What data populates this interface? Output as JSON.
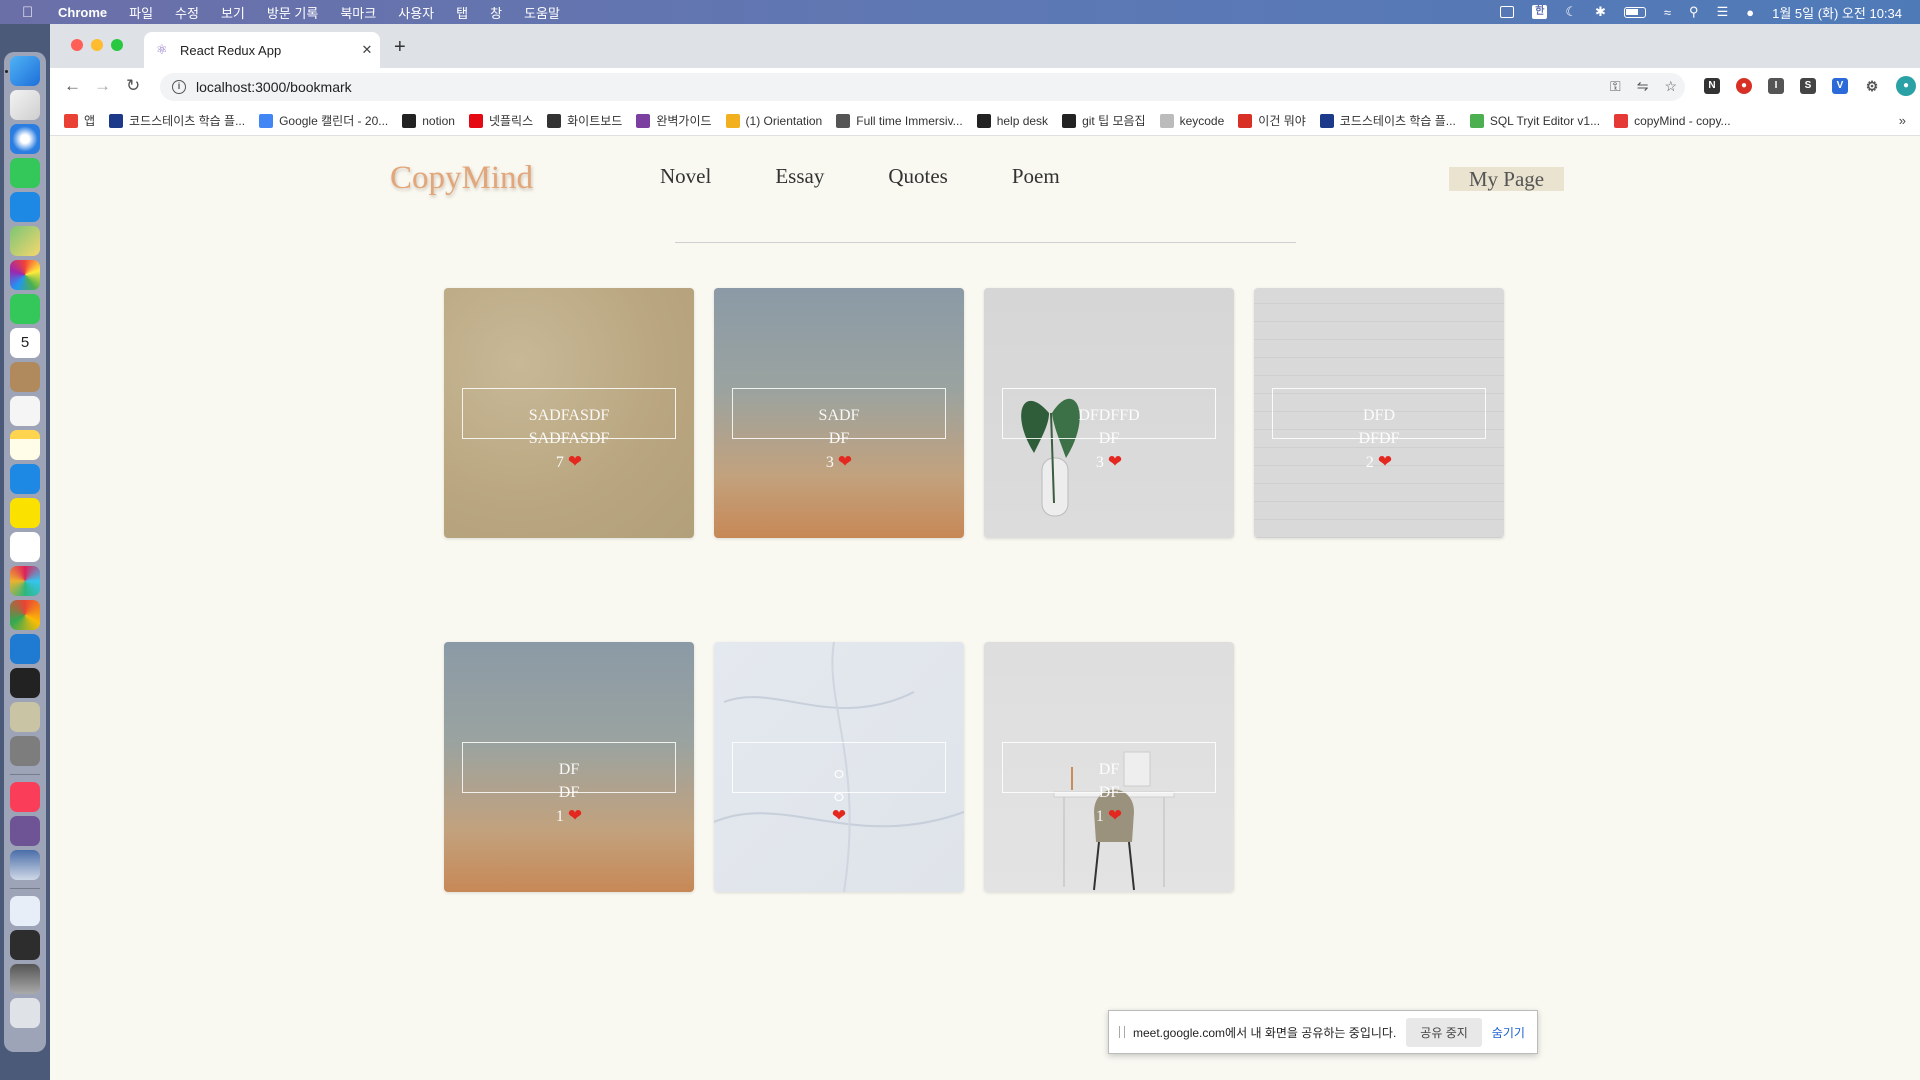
{
  "menubar": {
    "app": "Chrome",
    "menus": [
      "파일",
      "수정",
      "보기",
      "방문 기록",
      "북마크",
      "사용자",
      "탭",
      "창",
      "도움말"
    ],
    "ime": "한",
    "datetime": "1월 5일 (화) 오전 10:34"
  },
  "browser": {
    "tab_title": "React Redux App",
    "url": "localhost:3000/bookmark",
    "bookmarks": [
      {
        "label": "앱",
        "color": "#e94235"
      },
      {
        "label": "코드스테이츠 학습 플...",
        "color": "#1d3a8a"
      },
      {
        "label": "Google 캘린더 - 20...",
        "color": "#4285f4"
      },
      {
        "label": "notion",
        "color": "#222222"
      },
      {
        "label": "넷플릭스",
        "color": "#e50914"
      },
      {
        "label": "화이트보드",
        "color": "#333333"
      },
      {
        "label": "완벽가이드",
        "color": "#7b3fa0"
      },
      {
        "label": "(1) Orientation",
        "color": "#f2b01e"
      },
      {
        "label": "Full time Immersiv...",
        "color": "#555555"
      },
      {
        "label": "help desk",
        "color": "#222222"
      },
      {
        "label": "git 팁 모음집",
        "color": "#222222"
      },
      {
        "label": "keycode",
        "color": "#bbbbbb"
      },
      {
        "label": "이건 뭐야",
        "color": "#d93025"
      },
      {
        "label": "코드스테이츠 학습 플...",
        "color": "#1d3a8a"
      },
      {
        "label": "SQL Tryit Editor v1...",
        "color": "#4caf50"
      },
      {
        "label": "copyMind - copy...",
        "color": "#e53935"
      }
    ],
    "more": "»"
  },
  "site": {
    "logo": "CopyMind",
    "nav": [
      "Novel",
      "Essay",
      "Quotes",
      "Poem"
    ],
    "mypage": "My Page"
  },
  "cards": [
    {
      "title": "SADFASDF",
      "author": "SADFASDF",
      "likes": "7"
    },
    {
      "title": "SADF",
      "author": "DF",
      "likes": "3"
    },
    {
      "title": "DFDFFD",
      "author": "DF",
      "likes": "3"
    },
    {
      "title": "DFD",
      "author": "DFDF",
      "likes": "2"
    },
    {
      "title": "DF",
      "author": "DF",
      "likes": "1"
    },
    {
      "title": "ㅇ",
      "author": "ㅇ",
      "likes": ""
    },
    {
      "title": "DF",
      "author": "DF",
      "likes": "1"
    }
  ],
  "share": {
    "message": "meet.google.com에서 내 화면을 공유하는 중입니다.",
    "stop": "공유 중지",
    "hide": "숨기기"
  },
  "dock": {
    "calendar_day": "5"
  }
}
